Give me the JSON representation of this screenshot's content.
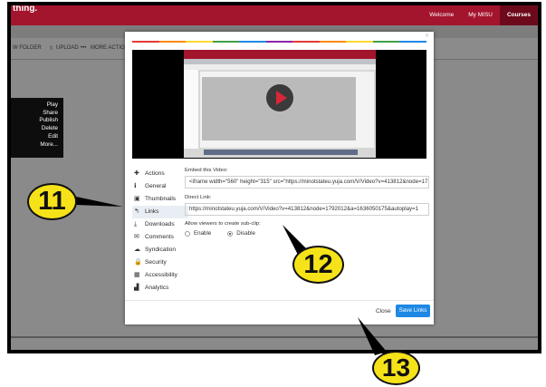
{
  "header": {
    "brand": "thing.",
    "nav": [
      "Welcome",
      "My MISU",
      "Courses"
    ]
  },
  "toolbar": {
    "new_folder": "W FOLDER",
    "upload": "UPLOAD",
    "more_actions": "MORE ACTIONS"
  },
  "context_menu": [
    "Play",
    "Share",
    "Publish",
    "Delete",
    "Edit",
    "More..."
  ],
  "modal": {
    "close_icon": "close-icon",
    "rainbow_colors": [
      "#e53935",
      "#fb8c00",
      "#fdd835",
      "#43a047",
      "#1e88e5",
      "#8e24aa",
      "#e53935",
      "#fb8c00",
      "#fdd835",
      "#43a047",
      "#1e88e5"
    ],
    "sidebar": [
      {
        "label": "Actions",
        "icon": "plus-icon",
        "glyph": "✚"
      },
      {
        "label": "General",
        "icon": "info-icon",
        "glyph": "ℹ"
      },
      {
        "label": "Thumbnails",
        "icon": "camera-icon",
        "glyph": "▣"
      },
      {
        "label": "Links",
        "icon": "share-icon",
        "glyph": "↰"
      },
      {
        "label": "Downloads",
        "icon": "download-icon",
        "glyph": "⤓"
      },
      {
        "label": "Comments",
        "icon": "comments-icon",
        "glyph": "✉"
      },
      {
        "label": "Syndication",
        "icon": "cloud-icon",
        "glyph": "☁"
      },
      {
        "label": "Security",
        "icon": "lock-icon",
        "glyph": "🔒"
      },
      {
        "label": "Accessibility",
        "icon": "cc-icon",
        "glyph": "▦"
      },
      {
        "label": "Analytics",
        "icon": "chart-icon",
        "glyph": "▟"
      }
    ],
    "embed_label": "Embed this Video:",
    "embed_value": "<iframe width=\"560\" height=\"315\" src=\"https://minotstateu.yuja.com/V/Video?v=413812&node=17",
    "direct_label": "Direct Link:",
    "direct_value": "https://minotstateu.yuja.com/V/Video?v=413812&node=1792012&a=1636050175&autoplay=1",
    "subclip_label": "Allow viewers to create sub-clip:",
    "enable": "Enable",
    "disable": "Disable",
    "close_btn": "Close",
    "save_btn": "Save Links"
  },
  "callouts": [
    "11",
    "12",
    "13"
  ]
}
